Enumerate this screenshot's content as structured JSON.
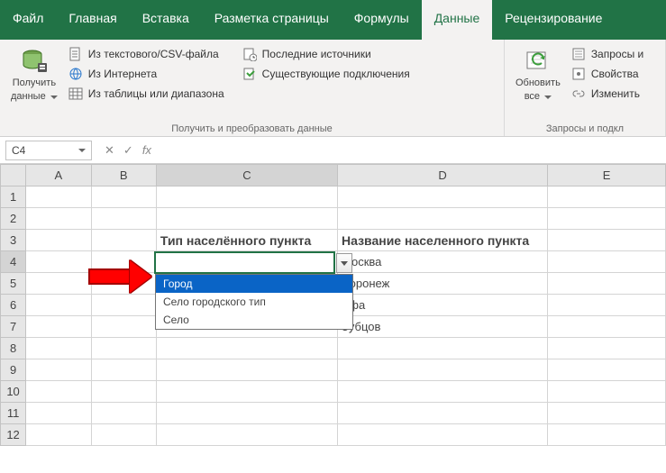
{
  "tabs": {
    "file": "Файл",
    "home": "Главная",
    "insert": "Вставка",
    "page_layout": "Разметка страницы",
    "formulas": "Формулы",
    "data": "Данные",
    "review": "Рецензирование"
  },
  "ribbon": {
    "get_data": {
      "line1": "Получить",
      "line2": "данные"
    },
    "from_csv": "Из текстового/CSV-файла",
    "from_web": "Из Интернета",
    "from_table": "Из таблицы или диапазона",
    "recent_sources": "Последние источники",
    "existing_conn": "Существующие подключения",
    "group1_label": "Получить и преобразовать данные",
    "refresh": {
      "line1": "Обновить",
      "line2": "все"
    },
    "queries": "Запросы и",
    "properties": "Свойства",
    "edit_links": "Изменить",
    "group2_label": "Запросы и подкл"
  },
  "name_box": "C4",
  "fx_label": "fx",
  "columns": [
    "A",
    "B",
    "C",
    "D",
    "E"
  ],
  "rows": [
    "1",
    "2",
    "3",
    "4",
    "5",
    "6",
    "7",
    "8",
    "9",
    "10",
    "11",
    "12"
  ],
  "cells": {
    "C3": "Тип населённого пункта",
    "D3": "Название населенного пункта",
    "D4": "Москва",
    "D5": "Воронеж",
    "D6": "Уфа",
    "D7": "Зубцов"
  },
  "dropdown": {
    "items": [
      "Город",
      "Село городского тип",
      "Село"
    ],
    "selected_index": 0
  }
}
